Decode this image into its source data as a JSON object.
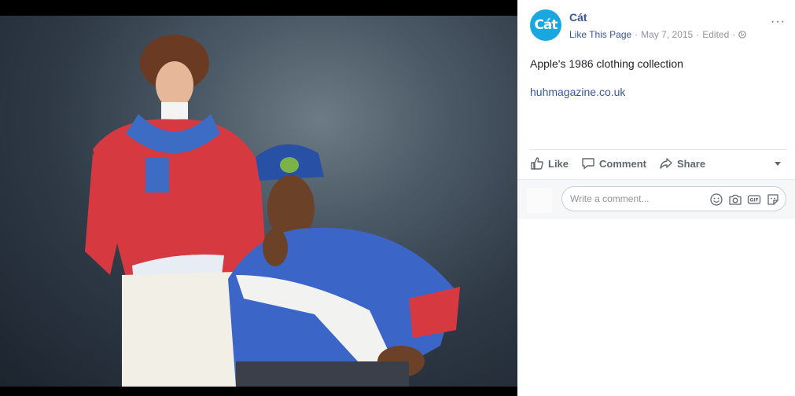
{
  "page": {
    "name": "Cát",
    "avatar_text": "Cát",
    "like_this_page": "Like This Page",
    "date": "May 7, 2015",
    "edited": "Edited",
    "separator": "·",
    "more_label": "···"
  },
  "post": {
    "text": "Apple's 1986 clothing collection",
    "link": "huhmagazine.co.uk"
  },
  "actions": {
    "like": "Like",
    "comment": "Comment",
    "share": "Share"
  },
  "comment_box": {
    "placeholder": "Write a comment..."
  },
  "icons": {
    "globe": "globe-icon",
    "like": "thumbs-up-icon",
    "comment": "speech-bubble-icon",
    "share": "share-arrow-icon",
    "emoji": "smiley-icon",
    "camera": "camera-icon",
    "gif": "gif-icon",
    "sticker": "sticker-icon"
  },
  "colors": {
    "link_blue": "#365899",
    "meta_gray": "#90949c",
    "brand_avatar": "#19a7e0"
  }
}
